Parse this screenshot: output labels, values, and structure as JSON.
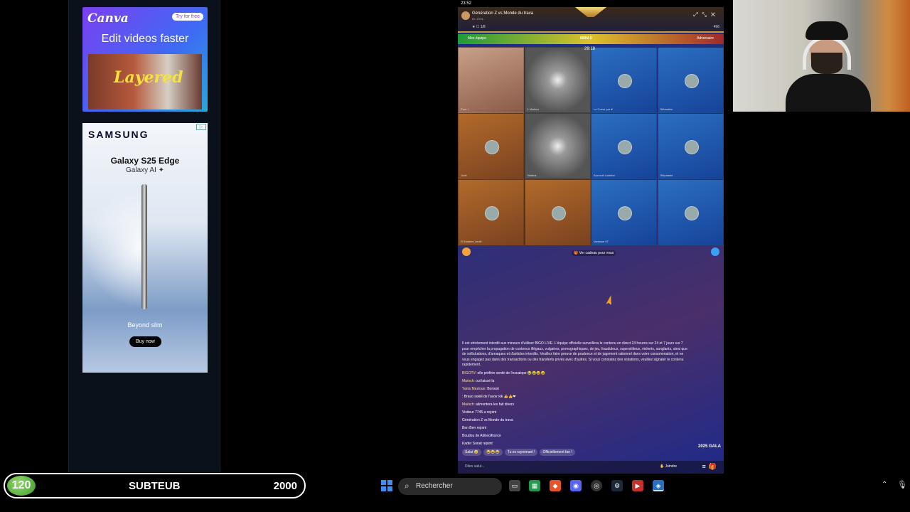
{
  "status_bar": {
    "time": "23:52"
  },
  "ads": {
    "canva": {
      "brand": "Canva",
      "cta": "Try for free",
      "headline": "Edit videos faster",
      "overlay_word": "Layered"
    },
    "samsung": {
      "brand": "SAMSUNG",
      "model": "Galaxy S25 Edge",
      "ai": "Galaxy AI ✦",
      "slogan": "Beyond slim",
      "cta": "Buy now"
    }
  },
  "room": {
    "title": "Génération Z vs Monde du trava",
    "subtitle": "ID: 1374...",
    "rank": "1/8",
    "online": "496",
    "pk_left": "Mes équipe",
    "pk_center": "800M 0",
    "pk_right": "Adversaire",
    "timer": "29:18",
    "sound_banner": "Ver cadeau pour vous",
    "seats": [
      {
        "name": "Pure ♀",
        "style": "face"
      },
      {
        "name": "1 Visiteur",
        "style": "gray"
      },
      {
        "name": "Le Coeur pur ♥",
        "style": "blue"
      },
      {
        "name": "Sébastien",
        "style": "blue"
      },
      {
        "name": "Jude",
        "style": "orange"
      },
      {
        "name": "Visiteur",
        "style": "gray"
      },
      {
        "name": "Asa nuit Lumière",
        "style": "blue"
      },
      {
        "name": "Stéphanie",
        "style": "blue"
      },
      {
        "name": "El Hadrien Lentil",
        "style": "orange"
      },
      {
        "name": "",
        "style": "orange"
      },
      {
        "name": "Vanesse 97",
        "style": "blue"
      },
      {
        "name": "",
        "style": "blue"
      }
    ],
    "notice": "Il est strictement interdit aux mineurs d'utiliser BIGO LIVE. L'équipe officielle surveillera le contenu en direct 24 heures sur 24 et 7 jours sur 7 pour empêcher la propagation de contenus illégaux, vulgaires, pornographiques, de jeu, frauduleux, superstitieux, violents, sanglants, ainsi que de sollicitations, d'arnaques et d'articles interdits. Veuillez faire preuve de prudence et de jugement rationnel dans votre consommation, et ne vous engagez pas dans des transactions ou des transferts privés avec d'autres. Si vous constatez des violations, veuillez signaler le contenu rapidement.",
    "chat": [
      {
        "name": "BIGOTV",
        "text": ": elle préfère sentir de l'escalope 😂😂😂😂"
      },
      {
        "name": "Maïoch",
        "text": ": oui laissé la"
      },
      {
        "name": "Yanis Mezioue",
        "text": ": Bonsoir"
      },
      {
        "name": "",
        "text": ": Bravo soleil de l'avoir kik 👍👍❤"
      },
      {
        "name": "Maïoch",
        "text": ": alimentera les fait divers"
      },
      {
        "name": "",
        "text": "Visiteur 7745 a rejoint"
      },
      {
        "name": "",
        "text": "Génération Z vs Monde du trava"
      },
      {
        "name": "",
        "text": "Ben Ben rejoint"
      },
      {
        "name": "",
        "text": "Boudou de Abbeoifrance"
      },
      {
        "name": "",
        "text": "Kader Sonat rejoint"
      }
    ],
    "quick_replies": [
      "Salut 😊",
      "😂😂😂",
      "Tu es rayonnant !",
      "Officiellement fan !"
    ],
    "input_placeholder": "Dites salut...",
    "join_label": "Joindre",
    "gala": "2025 GALA"
  },
  "sub_bar": {
    "count": "120",
    "label": "SUBTEUB",
    "goal": "2000"
  },
  "taskbar": {
    "search_placeholder": "Rechercher"
  },
  "colors": {
    "accent_green": "#3f9a2a",
    "bigo_blue": "#1b2c8a",
    "cursor": "#f5a21a"
  }
}
